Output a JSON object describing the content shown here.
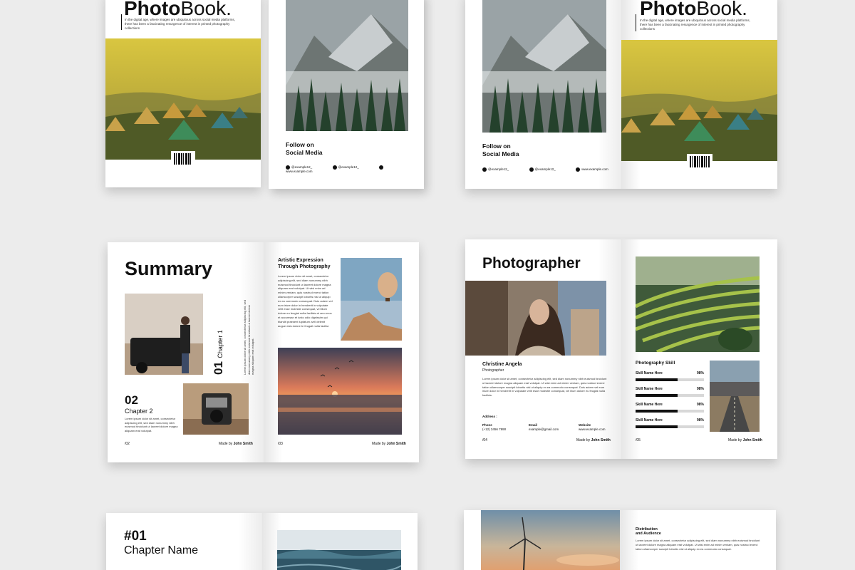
{
  "cover": {
    "title_bold": "Photo",
    "title_light": "Book.",
    "blurb": "In the digital age, where images are ubiquitous across social media platforms, there has been a fascinating resurgence of interest in printed photography collections"
  },
  "back": {
    "follow": "Follow on",
    "social": "Social Media",
    "handle_ig": "@example12_",
    "handle_x": "@example12_",
    "website": "www.example.com"
  },
  "summary": {
    "title": "Summary",
    "chapter1_num": "01",
    "chapter1_label": "Chapter 1",
    "chapter2_num": "02",
    "chapter2_label": "Chapter 2",
    "page_left": "/02",
    "page_right": "/03",
    "made_by": "Made by",
    "author": "John Smith",
    "article_title_1": "Artistic Expression",
    "article_title_2": "Through Photography",
    "lorem": "Lorem ipsum dolor sit amet, consectetur adipiscing elit, sed diam nonummy nibh euismod tincidunt ut laoreet dolore magna aliquam erat volutpat. Ut wisi enim ad minim veniam, quis nostrud exerci tation ullamcorper suscipit lobortis nisl ut aliquip ex ea commodo consequat. Duis autem vel eum iriure dolor in hendrerit in vulputate velit esse molestie consequat, vel illum dolore eu feugiat nulla facilisis at vero eros et accumsan et iusto odio dignissim qui blandit praesent luptatum zzril delenit augue duis dolore te feugait nulla facilisi.",
    "lorem_short": "Lorem ipsum dolor sit amet, consectetur adipiscing elit, sed diam nonummy nibh euismod tincidunt ut laoreet dolore magna aliquam erat volutpat."
  },
  "photographer": {
    "title": "Photographer",
    "name": "Christine Angela",
    "role": "Photographer",
    "bio": "Lorem ipsum dolor sit amet, consectetur adipiscing elit, sed diam nonummy nibh euismod tincidunt ut laoreet dolore magna aliquam erat volutpat. Ut wisi enim ad minim veniam, quis nostrud exerci tation ullamcorper suscipit lobortis nisl ut aliquip ex ea commodo consequat. Duis autem vel eum iriure dolor in hendrerit in vulputate velit esse molestie consequat, vel illum dolore eu feugiat nulla facilisis.",
    "address_label": "Address :",
    "phone_label": "Phone",
    "phone": "(+12) 3456 7890",
    "email_label": "Email",
    "email": "example@gmail.com",
    "website_label": "Website",
    "website": "www.example.com",
    "page_left": "/04",
    "page_right": "/05",
    "made_by": "Made by",
    "author": "John Smith",
    "skill_heading": "Photography Skill",
    "skills": [
      {
        "name": "Skill Name Here",
        "pct_label": "98%",
        "pct": 98
      },
      {
        "name": "Skill Name Here",
        "pct_label": "98%",
        "pct": 98
      },
      {
        "name": "Skill Name Here",
        "pct_label": "98%",
        "pct": 98
      },
      {
        "name": "Skill Name Here",
        "pct_label": "98%",
        "pct": 98
      }
    ]
  },
  "chapter": {
    "num": "#01",
    "name": "Chapter Name"
  },
  "distribution": {
    "title_1": "Distribution",
    "title_2": "and Audience",
    "body": "Lorem ipsum dolor sit amet, consectetur adipiscing elit, sed diam nonummy nibh euismod tincidunt ut laoreet dolore magna aliquam erat volutpat. Ut wisi enim ad minim veniam, quis nostrud exerci tation ullamcorper suscipit lobortis nisl ut aliquip ex ea commodo consequat."
  }
}
